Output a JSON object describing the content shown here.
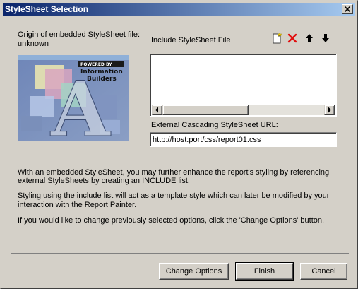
{
  "window": {
    "title": "StyleSheet Selection"
  },
  "origin": {
    "line1": "Origin of embedded StyleSheet file:",
    "line2": "unknown"
  },
  "logo": {
    "line1": "POWERED BY",
    "line2": "Information",
    "line3": "Builders",
    "letter": "A"
  },
  "include": {
    "label": "Include StyleSheet File",
    "toolbar": [
      "new-file-icon",
      "delete-icon",
      "move-up-icon",
      "move-down-icon"
    ],
    "items": []
  },
  "external_url": {
    "label": "External Cascading StyleSheet URL:",
    "value": "http://host:port/css/report01.css"
  },
  "info": {
    "p1_line1": "With an embedded StyleSheet, you may further enhance the report's styling by referencing",
    "p1_line2": "external StyleSheets by creating an INCLUDE list.",
    "p2_line1": "Styling using the include list will act as a template style which can later be modified by your",
    "p2_line2": "interaction with the Report Painter.",
    "p3": "If you would like to change previously selected options, click the 'Change Options' button."
  },
  "buttons": {
    "change_options": "Change Options",
    "finish": "Finish",
    "cancel": "Cancel"
  },
  "colors": {
    "titlebar_start": "#0a246a",
    "titlebar_end": "#a6caf0",
    "delete_red": "#e01010",
    "dialog_bg": "#d4d0c8"
  }
}
